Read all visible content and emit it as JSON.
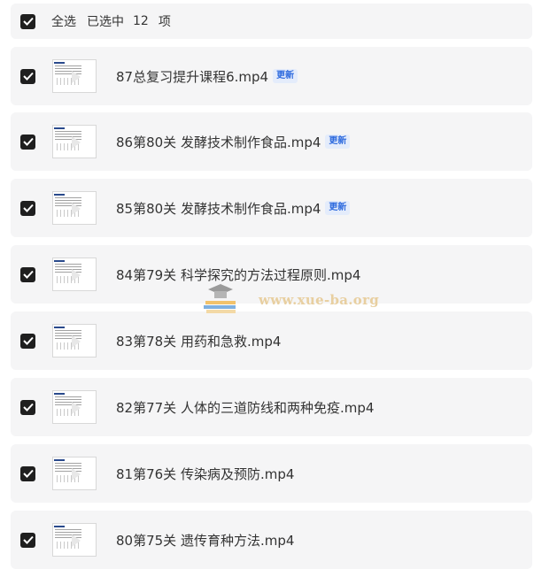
{
  "select_all": {
    "label": "全选",
    "selected_prefix": "已选中",
    "selected_count": "12",
    "unit": "项"
  },
  "files": [
    {
      "name": "87总复习提升课程6.mp4",
      "badge": "更新",
      "checked": true
    },
    {
      "name": "86第80关 发酵技术制作食品.mp4",
      "badge": "更新",
      "checked": true
    },
    {
      "name": "85第80关 发酵技术制作食品.mp4",
      "badge": "更新",
      "checked": true
    },
    {
      "name": "84第79关 科学探究的方法过程原则.mp4",
      "badge": "",
      "checked": true
    },
    {
      "name": "83第78关 用药和急救.mp4",
      "badge": "",
      "checked": true
    },
    {
      "name": "82第77关 人体的三道防线和两种免疫.mp4",
      "badge": "",
      "checked": true
    },
    {
      "name": "81第76关 传染病及预防.mp4",
      "badge": "",
      "checked": true
    },
    {
      "name": "80第75关 遗传育种方法.mp4",
      "badge": "",
      "checked": true
    }
  ],
  "watermark": {
    "text": "www.xue-ba.org"
  },
  "colors": {
    "row_background": "#f5f5f6",
    "checkbox": "#1f1f1f",
    "badge_text": "#2f6bde",
    "badge_background": "#e4ecfb",
    "watermark_text": "#e8cfa0"
  },
  "icons": {
    "checkbox": "checkmark-icon",
    "thumbnail": "video-thumbnail-play-icon",
    "watermark_logo": "graduation-cap-books-icon"
  }
}
